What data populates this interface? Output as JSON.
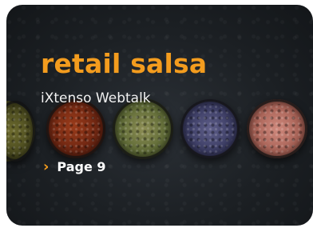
{
  "card": {
    "title": "retail salsa",
    "subtitle": "iXtenso Webtalk",
    "link_label": "Page 9"
  },
  "colors": {
    "accent": "#f39c1e",
    "background": "#1c2024",
    "text": "#ffffff"
  },
  "icons": {
    "link_arrow": "chevron-right-icon"
  }
}
